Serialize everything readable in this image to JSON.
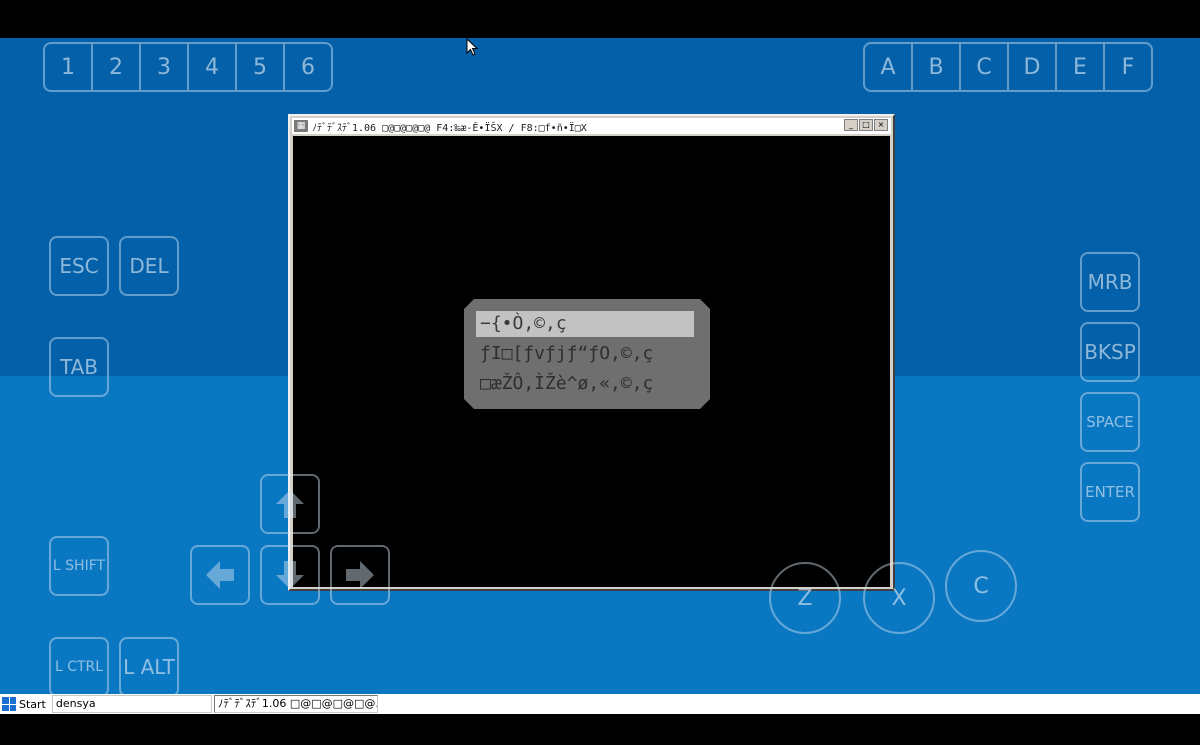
{
  "number_keys": [
    "1",
    "2",
    "3",
    "4",
    "5",
    "6"
  ],
  "letter_keys": [
    "A",
    "B",
    "C",
    "D",
    "E",
    "F"
  ],
  "left_buttons": {
    "esc": "ESC",
    "del": "DEL",
    "tab": "TAB",
    "lshift": "L SHIFT",
    "lctrl": "L CTRL",
    "lalt": "L ALT"
  },
  "right_buttons": {
    "mrb": "MRB",
    "bksp": "BKSP",
    "space": "SPACE",
    "enter": "ENTER"
  },
  "action_buttons": {
    "z": "Z",
    "x": "X",
    "c": "C"
  },
  "window": {
    "title": "ﾉﾃﾞﾃﾞｽﾃﾞ1.06 □@□@□@□@ F4:‰æ-Ê•ÏŠX / F8:□f•ñ•Ï□X"
  },
  "menu": {
    "items": [
      "−{•Ò,©,ç",
      "ƒI□[ƒvƒjƒ“ƒO,©,ç",
      "□æŽÔ,ÌŽè^ø,«,©,ç"
    ],
    "selected_index": 0
  },
  "taskbar": {
    "start_label": "Start",
    "tasks": [
      "densya",
      "ﾉﾃﾞﾃﾞｽﾃﾞ1.06 □@□@□@□@..."
    ]
  }
}
